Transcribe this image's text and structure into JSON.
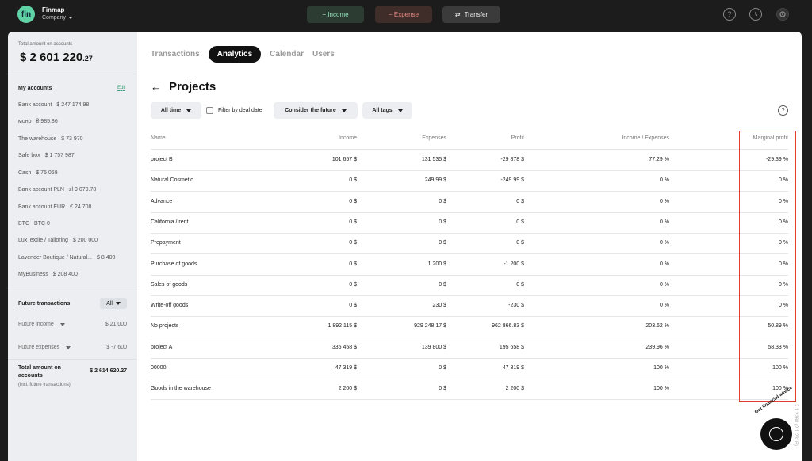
{
  "app": {
    "logo": "fin",
    "name": "Finmap",
    "company": "Company"
  },
  "topbar": {
    "income": "+ Income",
    "expense": "− Expense",
    "transfer_icon": "⇄",
    "transfer": "Transfer",
    "icons": [
      "help-icon",
      "history-icon",
      "gear-icon"
    ]
  },
  "sidebar": {
    "total_label": "Total amount on accounts",
    "total_main": "$ 2 601 220",
    "total_cents": ".27",
    "my_accounts": "My accounts",
    "edit": "Edit",
    "accounts": [
      {
        "name": "Bank account",
        "value": "$ 247 174.98"
      },
      {
        "name": "моно",
        "value": "₴ 985.86"
      },
      {
        "name": "The warehouse",
        "value": "$ 73 970"
      },
      {
        "name": "Safe box",
        "value": "$ 1 757 987"
      },
      {
        "name": "Cash",
        "value": "$ 75 068"
      },
      {
        "name": "Bank account PLN",
        "value": "zł 9 079.78"
      },
      {
        "name": "Bank account EUR",
        "value": "€ 24 708"
      },
      {
        "name": "BTC",
        "value": "BTC 0"
      },
      {
        "name": "LuxTextile / Tailoring",
        "value": "$ 200 000"
      },
      {
        "name": "Lavender Boutique / Natural...",
        "value": "$ 8 400"
      },
      {
        "name": "MyBusiness",
        "value": "$ 208 400"
      }
    ],
    "future_title": "Future transactions",
    "future_filter": "All",
    "future_income": "Future income",
    "future_income_value": "$ 21 000",
    "future_expenses": "Future expenses",
    "future_expenses_value": "$ -7 600",
    "total_future_label": "Total amount on accounts",
    "total_future_note": "(incl. future transactions)",
    "total_future_value": "$ 2 614 620.27"
  },
  "main": {
    "tabs": [
      "Transactions",
      "Analytics",
      "Calendar",
      "Users"
    ],
    "active_tab": "Analytics",
    "back": "←",
    "title": "Projects",
    "filters": {
      "time": "All time",
      "deal_date": "Filter by deal date",
      "future": "Consider the future",
      "tags": "All tags"
    },
    "help": "?",
    "columns": [
      "Name",
      "Income",
      "Expenses",
      "Profit",
      "Income / Expenses",
      "Marginal profit"
    ],
    "rows": [
      [
        "project B",
        "101 657  $",
        "131 535  $",
        "-29 878  $",
        "77.29 %",
        "-29.39 %"
      ],
      [
        "Natural Cosmetic",
        "0  $",
        "249.99  $",
        "-249.99  $",
        "0 %",
        "0 %"
      ],
      [
        "Advance",
        "0  $",
        "0  $",
        "0  $",
        "0 %",
        "0 %"
      ],
      [
        "California / rent",
        "0  $",
        "0  $",
        "0  $",
        "0 %",
        "0 %"
      ],
      [
        "Prepayment",
        "0  $",
        "0  $",
        "0  $",
        "0 %",
        "0 %"
      ],
      [
        "Purchase of goods",
        "0  $",
        "1 200  $",
        "-1 200  $",
        "0 %",
        "0 %"
      ],
      [
        "Sales of goods",
        "0  $",
        "0  $",
        "0  $",
        "0 %",
        "0 %"
      ],
      [
        "Write-off goods",
        "0  $",
        "230  $",
        "-230  $",
        "0 %",
        "0 %"
      ],
      [
        "No projects",
        "1 892 115  $",
        "929 248.17  $",
        "962 866.83  $",
        "203.62 %",
        "50.89 %"
      ],
      [
        "project A",
        "335 458  $",
        "139 800  $",
        "195 658  $",
        "239.96 %",
        "58.33 %"
      ],
      [
        "00000",
        "47 319  $",
        "0  $",
        "47 319  $",
        "100 %",
        "100 %"
      ],
      [
        "Goods in the warehouse",
        "2 200  $",
        "0  $",
        "2 200  $",
        "100 %",
        "100 %"
      ]
    ]
  },
  "advice": "Get financial advice",
  "version": "2.1.2280 (2.1.231B)",
  "colors": {
    "accent_green": "#5fd3a5",
    "highlight_red": "#e23c2f",
    "dark_bg": "#1c1c1c"
  }
}
